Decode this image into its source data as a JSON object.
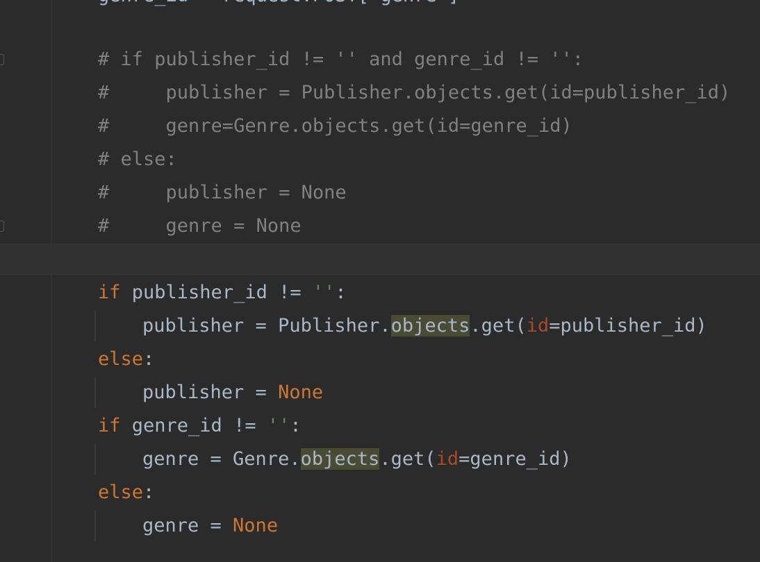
{
  "editor": {
    "partial_top_line": "genre_id = request.POST['genre']",
    "commented_block": [
      "# if publisher_id != '' and genre_id != '':",
      "#     publisher = Publisher.objects.get(id=publisher_id)",
      "#     genre=Genre.objects.get(id=genre_id)",
      "# else:",
      "#     publisher = None",
      "#     genre = None"
    ],
    "code": {
      "if1": {
        "kw": "if",
        "cond": " publisher_id != ",
        "str": "''",
        "colon": ":"
      },
      "assign1": {
        "pre": "publisher = Publisher.",
        "highlight": "objects",
        "mid": ".get(",
        "param": "id",
        "post": "=publisher_id)"
      },
      "else1": {
        "kw": "else",
        "colon": ":"
      },
      "assign2": {
        "pre": "publisher = ",
        "kw": "None"
      },
      "if2": {
        "kw": "if",
        "cond": " genre_id != ",
        "str": "''",
        "colon": ":"
      },
      "assign3": {
        "pre": "genre = Genre.",
        "highlight": "objects",
        "mid": ".get(",
        "param": "id",
        "post": "=genre_id)"
      },
      "else2": {
        "kw": "else",
        "colon": ":"
      },
      "assign4": {
        "pre": "genre = ",
        "kw": "None"
      }
    },
    "colors": {
      "background": "#2b2b2b",
      "keyword": "#cc7832",
      "string": "#6a8759",
      "comment": "#808080",
      "param": "#aa4926",
      "text": "#a9b7c6",
      "usage_highlight": "#4a4b34"
    }
  }
}
